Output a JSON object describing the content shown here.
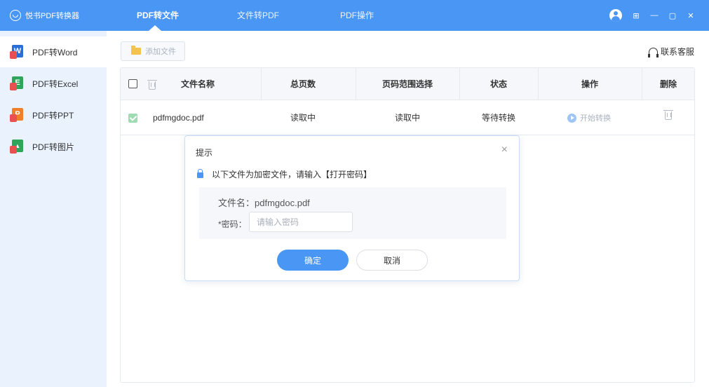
{
  "app": {
    "title": "悦书PDF转换器"
  },
  "nav": {
    "tabs": [
      {
        "label": "PDF转文件",
        "active": true
      },
      {
        "label": "文件转PDF",
        "active": false
      },
      {
        "label": "PDF操作",
        "active": false
      }
    ]
  },
  "window_controls": [
    "avatar-icon",
    "grid-icon",
    "minimize-icon",
    "maximize-icon",
    "close-icon"
  ],
  "sidebar": {
    "items": [
      {
        "label": "PDF转Word",
        "icon": "word-icon",
        "letter": "W",
        "color": "#2b6fd6",
        "active": true
      },
      {
        "label": "PDF转Excel",
        "icon": "excel-icon",
        "letter": "E",
        "color": "#2ea55a",
        "active": false
      },
      {
        "label": "PDF转PPT",
        "icon": "ppt-icon",
        "letter": "P",
        "color": "#f07f2a",
        "active": false
      },
      {
        "label": "PDF转图片",
        "icon": "image-icon",
        "letter": "▲",
        "color": "#2ea55a",
        "active": false
      }
    ]
  },
  "toolbar": {
    "add_file_label": "添加文件",
    "contact_label": "联系客服"
  },
  "table": {
    "headers": {
      "filename": "文件名称",
      "pages": "总页数",
      "range": "页码范围选择",
      "status": "状态",
      "action": "操作",
      "delete": "删除"
    },
    "rows": [
      {
        "checked": true,
        "filename": "pdfmgdoc.pdf",
        "pages": "读取中",
        "range": "读取中",
        "status": "等待转换",
        "action": "开始转换"
      }
    ]
  },
  "dialog": {
    "title": "提示",
    "message": "以下文件为加密文件，请输入【打开密码】",
    "filename_label": "文件名：",
    "filename_value": "pdfmgdoc.pdf",
    "password_label": "*密码：",
    "password_placeholder": "请输入密码",
    "password_value": "",
    "confirm_label": "确定",
    "cancel_label": "取消"
  },
  "colors": {
    "primary": "#4a96f5",
    "sidebar_bg": "#e9f2fd",
    "checkbox_checked": "#9fdbb1"
  }
}
